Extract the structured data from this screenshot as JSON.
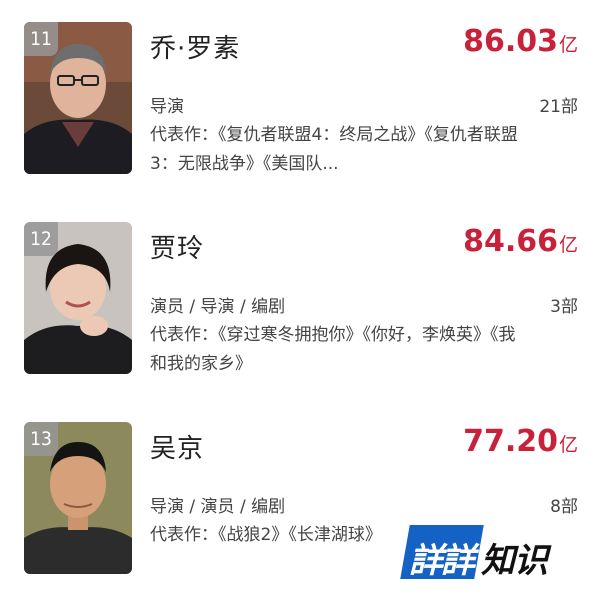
{
  "entries": [
    {
      "rank": "11",
      "name": "乔·罗素",
      "amount": "86.03",
      "unit": "亿",
      "role": "导演",
      "count": "21部",
      "works": "代表作：《复仇者联盟4：终局之战》《复仇者联盟3：无限战争》《美国队..."
    },
    {
      "rank": "12",
      "name": "贾玲",
      "amount": "84.66",
      "unit": "亿",
      "role": "演员 / 导演 / 编剧",
      "count": "3部",
      "works": "代表作：《穿过寒冬拥抱你》《你好，李焕英》《我和我的家乡》"
    },
    {
      "rank": "13",
      "name": "吴京",
      "amount": "77.20",
      "unit": "亿",
      "role": "导演 / 演员 / 编剧",
      "count": "8部",
      "works": "代表作：《战狼2》《长津湖球》"
    }
  ],
  "watermark": {
    "part1": "詳詳",
    "part2": "知识"
  },
  "colors": {
    "amount": "#c8223a",
    "rank_badge": "#969696",
    "logo_blue": "#1463c4"
  }
}
